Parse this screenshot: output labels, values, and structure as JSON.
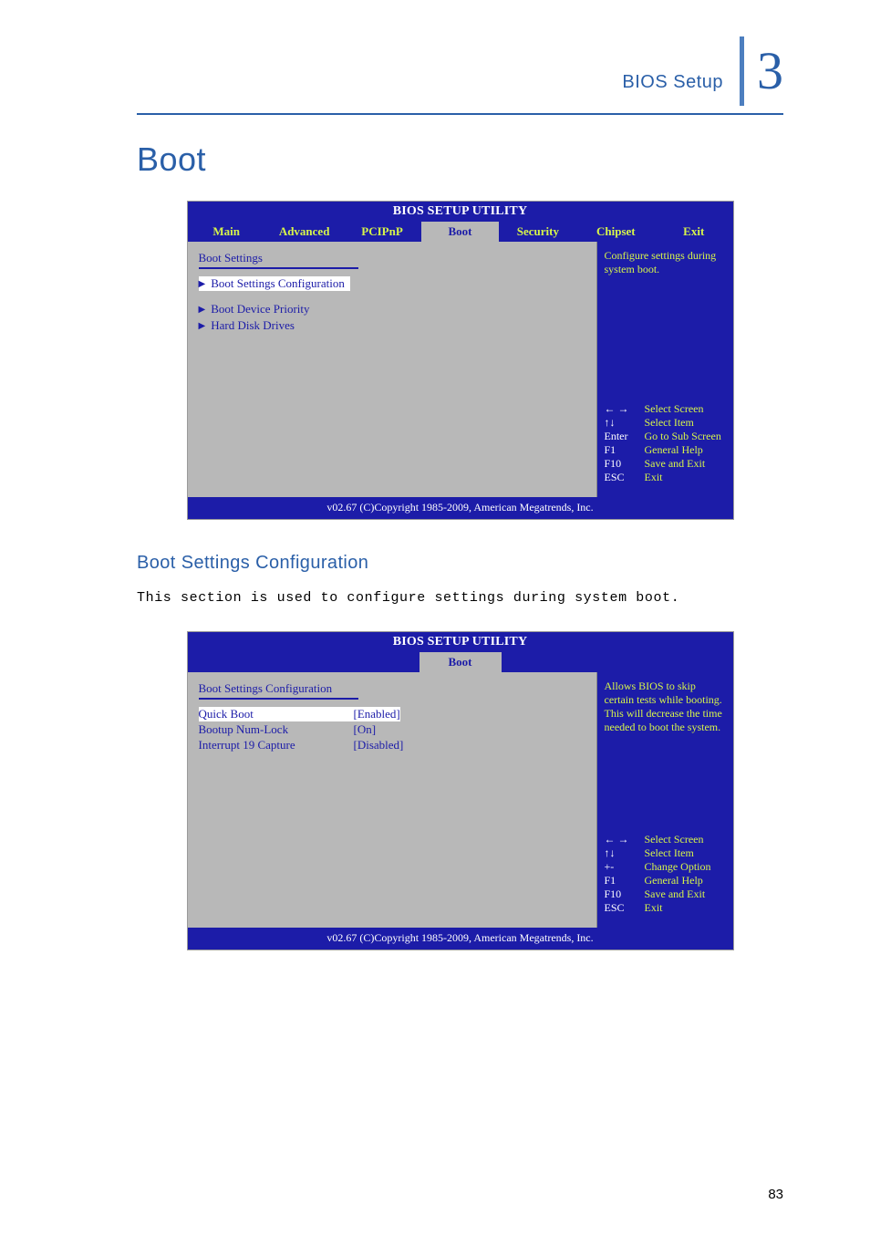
{
  "header": {
    "label": "BIOS Setup",
    "chapter": "3"
  },
  "section_title": "Boot",
  "bios1": {
    "title": "BIOS SETUP UTILITY",
    "tabs": [
      "Main",
      "Advanced",
      "PCIPnP",
      "Boot",
      "Security",
      "Chipset",
      "Exit"
    ],
    "active_tab": "Boot",
    "heading": "Boot Settings",
    "items": [
      {
        "label": "Boot Settings Configuration",
        "selected": true
      },
      {
        "label": "Boot Device Priority",
        "selected": false
      },
      {
        "label": "Hard Disk Drives",
        "selected": false
      }
    ],
    "help": "Configure settings during system boot.",
    "keys": [
      {
        "k": "← →",
        "d": "Select Screen"
      },
      {
        "k": "↑↓",
        "d": "Select Item"
      },
      {
        "k": "Enter",
        "d": "Go to Sub Screen"
      },
      {
        "k": "F1",
        "d": "General Help"
      },
      {
        "k": "F10",
        "d": "Save and Exit"
      },
      {
        "k": "ESC",
        "d": "Exit"
      }
    ],
    "footer": "v02.67 (C)Copyright 1985-2009, American Megatrends, Inc."
  },
  "subsection": {
    "title": "Boot Settings Configuration",
    "text": "This section is used to configure settings during system boot."
  },
  "bios2": {
    "title": "BIOS SETUP UTILITY",
    "tab": "Boot",
    "heading": "Boot Settings Configuration",
    "settings": [
      {
        "label": "Quick Boot",
        "value": "[Enabled]",
        "selected": true
      },
      {
        "label": "Bootup Num-Lock",
        "value": "[On]",
        "selected": false
      },
      {
        "label": "Interrupt 19 Capture",
        "value": "[Disabled]",
        "selected": false
      }
    ],
    "help": "Allows BIOS to skip certain tests while booting. This will decrease the time needed to boot the system.",
    "keys": [
      {
        "k": "← →",
        "d": "Select Screen"
      },
      {
        "k": "↑↓",
        "d": "Select Item"
      },
      {
        "k": "+-",
        "d": "Change Option"
      },
      {
        "k": "F1",
        "d": "General Help"
      },
      {
        "k": "F10",
        "d": "Save and Exit"
      },
      {
        "k": "ESC",
        "d": "Exit"
      }
    ],
    "footer": "v02.67 (C)Copyright 1985-2009, American Megatrends, Inc."
  },
  "page_number": "83"
}
